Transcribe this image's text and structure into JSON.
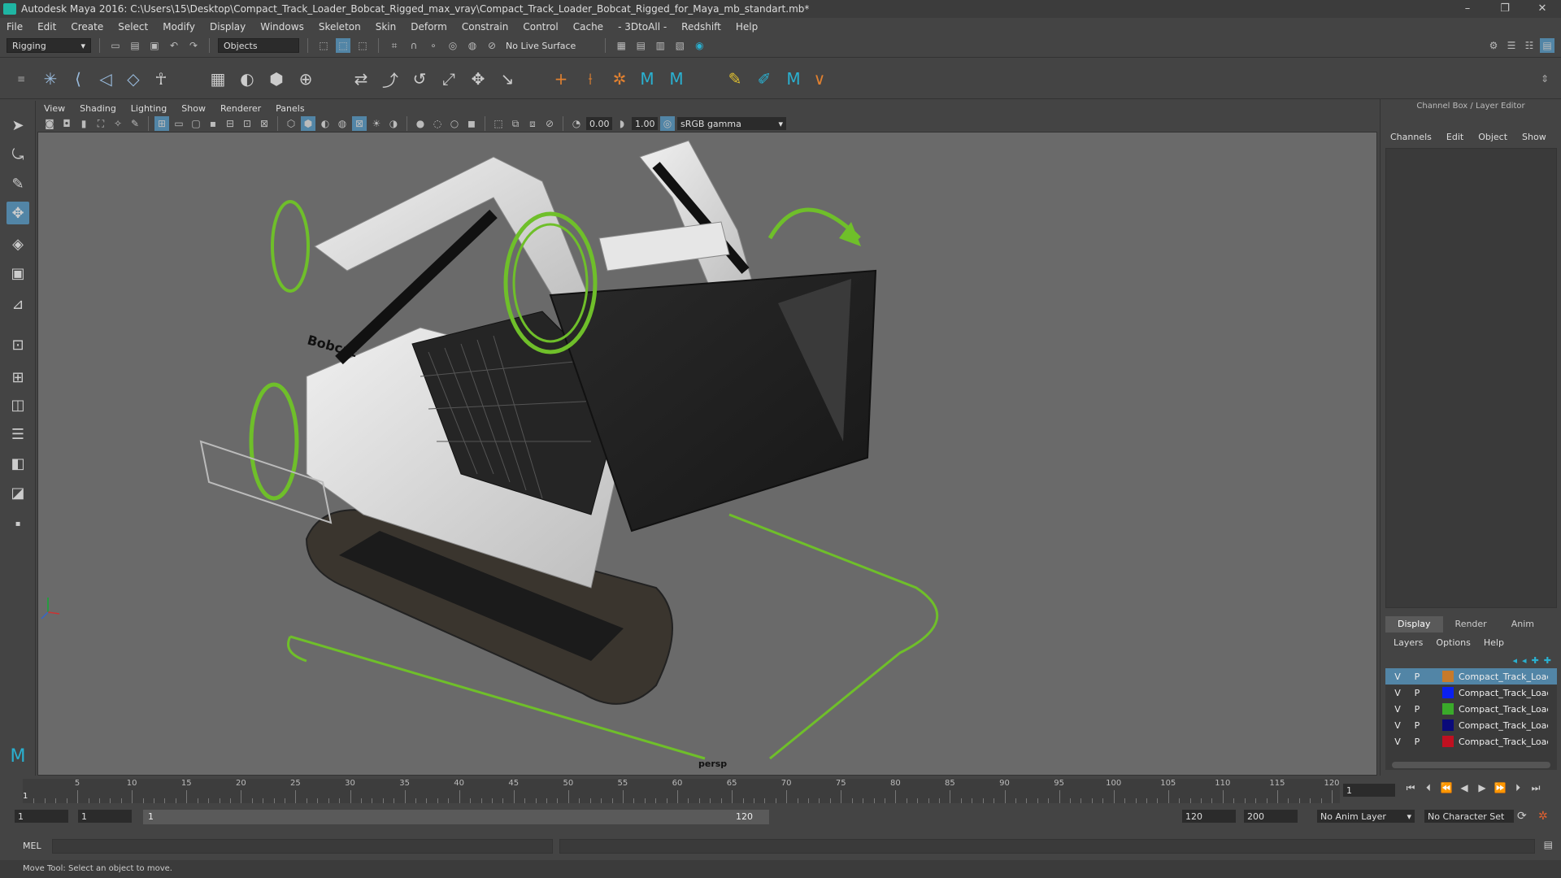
{
  "window": {
    "title": "Autodesk Maya 2016: C:\\Users\\15\\Desktop\\Compact_Track_Loader_Bobcat_Rigged_max_vray\\Compact_Track_Loader_Bobcat_Rigged_for_Maya_mb_standart.mb*",
    "minimize": "–",
    "restore": "❐",
    "close": "✕"
  },
  "menubar": [
    "File",
    "Edit",
    "Create",
    "Select",
    "Modify",
    "Display",
    "Windows",
    "Skeleton",
    "Skin",
    "Deform",
    "Constrain",
    "Control",
    "Cache",
    "- 3DtoAll -",
    "Redshift",
    "Help"
  ],
  "statusline": {
    "menuset": "Rigging",
    "selection_mode": "Objects",
    "live_surface": "No Live Surface"
  },
  "panel": {
    "menus": [
      "View",
      "Shading",
      "Lighting",
      "Show",
      "Renderer",
      "Panels"
    ],
    "exposure": "0.00",
    "gamma": "1.00",
    "color_space": "sRGB gamma",
    "camera": "persp"
  },
  "channel_box": {
    "header": "Channel Box / Layer Editor",
    "menus": [
      "Channels",
      "Edit",
      "Object",
      "Show"
    ],
    "layer_tabs": [
      "Display",
      "Render",
      "Anim"
    ],
    "layer_menus": [
      "Layers",
      "Options",
      "Help"
    ],
    "layers": [
      {
        "v": "V",
        "p": "P",
        "color": "#c77a2a",
        "name": "Compact_Track_Loader_Bobcat"
      },
      {
        "v": "V",
        "p": "P",
        "color": "#0a20f0",
        "name": "Compact_Track_Loader_Bobcat"
      },
      {
        "v": "V",
        "p": "P",
        "color": "#3aaa2a",
        "name": "Compact_Track_Loader_Bobcat"
      },
      {
        "v": "V",
        "p": "P",
        "color": "#0a0a7a",
        "name": "Compact_Track_Loader_Bobcat"
      },
      {
        "v": "V",
        "p": "P",
        "color": "#c01020",
        "name": "Compact_Track_Loader_Bobcat"
      }
    ]
  },
  "timeline": {
    "ticks": [
      "5",
      "10",
      "15",
      "20",
      "25",
      "30",
      "35",
      "40",
      "45",
      "50",
      "55",
      "60",
      "65",
      "70",
      "75",
      "80",
      "85",
      "90",
      "95",
      "100",
      "105",
      "110",
      "115",
      "120"
    ],
    "start_marker": "1",
    "current_frame": "1"
  },
  "range": {
    "start": "1",
    "playback_start": "1",
    "slider_start": "1",
    "slider_end": "120",
    "playback_end": "120",
    "end": "200",
    "anim_layer": "No Anim Layer",
    "character_set": "No Character Set"
  },
  "command": {
    "lang": "MEL"
  },
  "help_line": "Move Tool: Select an object to move.",
  "colors": {
    "accent": "#5285a6",
    "rig_green": "#6fbf2a",
    "viewport_bg": "#6a6a6a"
  }
}
